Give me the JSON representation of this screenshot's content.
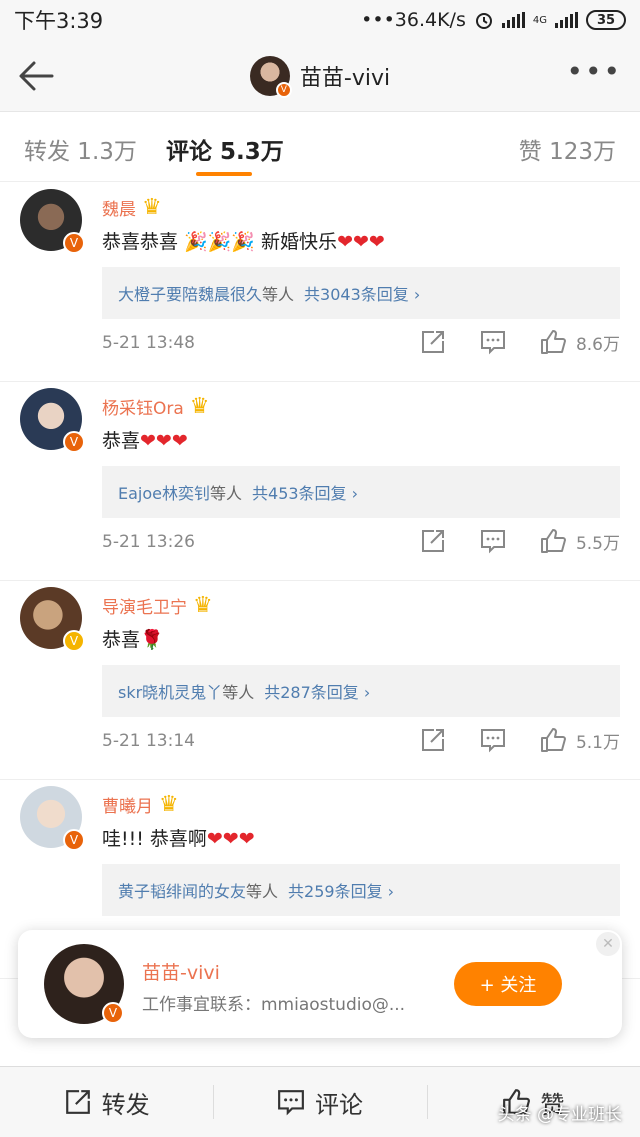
{
  "status": {
    "time": "下午3:39",
    "speed": "36.4K/s",
    "network": "4G",
    "battery": "35"
  },
  "header": {
    "title": "苗苗-vivi"
  },
  "tabs": [
    {
      "label": "转发 1.3万"
    },
    {
      "label": "评论 5.3万"
    },
    {
      "label": "赞 123万"
    }
  ],
  "comments": [
    {
      "name": "魏晨",
      "text": "恭喜恭喜 🎉🎉🎉 新婚快乐",
      "hearts": "❤❤❤",
      "reply_users": "大橙子要陪魏晨很久",
      "reply_mid": "等人",
      "reply_count": "共3043条回复 ›",
      "time": "5-21 13:48",
      "likes": "8.6万"
    },
    {
      "name": "杨采钰Ora",
      "text": "恭喜",
      "hearts": "❤❤❤",
      "reply_users": "Eajoe林奕钊",
      "reply_mid": "等人",
      "reply_count": "共453条回复 ›",
      "time": "5-21 13:26",
      "likes": "5.5万"
    },
    {
      "name": "导演毛卫宁",
      "text": "恭喜🌹",
      "hearts": "",
      "reply_users": "skr晓机灵鬼丫",
      "reply_mid": "等人",
      "reply_count": "共287条回复 ›",
      "time": "5-21 13:14",
      "likes": "5.1万"
    },
    {
      "name": "曹曦月",
      "text": "哇!!! 恭喜啊",
      "hearts": "❤❤❤",
      "reply_users": "黄子韬绯闻的女友",
      "reply_mid": "等人",
      "reply_count": "共259条回复 ›",
      "time": "",
      "likes": ""
    }
  ],
  "popup": {
    "name": "苗苗-vivi",
    "desc": "工作事宜联系：mmiaostudio@...",
    "follow_label": "+ 关注",
    "close": "✕"
  },
  "bottom": {
    "repost": "转发",
    "comment": "评论",
    "like": "赞"
  },
  "watermark": "头条 @专业班长",
  "colors": {
    "accent": "#ff8200",
    "name": "#eb7350",
    "link": "#507daf"
  }
}
